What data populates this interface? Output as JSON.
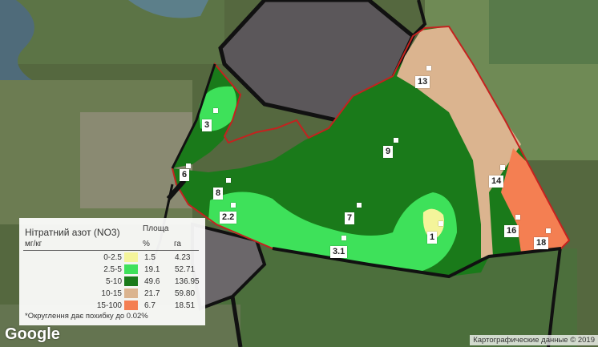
{
  "labels": {
    "l13": "13",
    "l3": "3",
    "l9": "9",
    "l6": "6",
    "l8": "8",
    "l14": "14",
    "l22": "2.2",
    "l7": "7",
    "l1": "1",
    "l16": "16",
    "l18": "18",
    "l31": "3.1"
  },
  "legend": {
    "title": "Нітратний азот (NO3)",
    "area_header": "Площа",
    "unit": "мг/кг",
    "pct_header": "%",
    "ha_header": "га",
    "rows": [
      {
        "range": "0-2.5",
        "color": "#f4f49a",
        "pct": "1.5",
        "ha": "4.23"
      },
      {
        "range": "2.5-5",
        "color": "#3ee15a",
        "pct": "19.1",
        "ha": "52.71"
      },
      {
        "range": "5-10",
        "color": "#1a7a1a",
        "pct": "49.6",
        "ha": "136.95"
      },
      {
        "range": "10-15",
        "color": "#dbb48f",
        "pct": "21.7",
        "ha": "59.80"
      },
      {
        "range": "15-100",
        "color": "#f47f52",
        "pct": "6.7",
        "ha": "18.51"
      }
    ],
    "footnote": "*Округлення дає похибку до 0.02%"
  },
  "google_logo": "Google",
  "attribution": "Картографические данные © 2019",
  "colors": {
    "yellow": "#f4f49a",
    "light_green": "#3ee15a",
    "dark_green": "#1a7a1a",
    "tan": "#dbb48f",
    "orange": "#f47f52",
    "boundary": "#cc2222"
  }
}
